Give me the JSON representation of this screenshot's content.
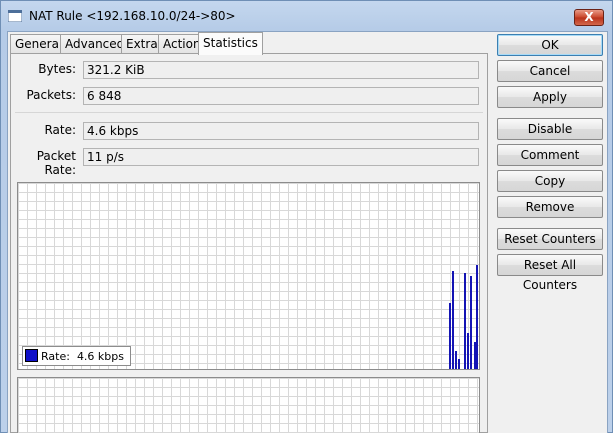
{
  "window": {
    "title": "NAT Rule <192.168.10.0/24->80>",
    "close_label": "X"
  },
  "tabs": [
    {
      "label": "General"
    },
    {
      "label": "Advanced"
    },
    {
      "label": "Extra"
    },
    {
      "label": "Action"
    },
    {
      "label": "Statistics",
      "active": true
    }
  ],
  "stats": {
    "bytes_label": "Bytes:",
    "bytes_value": "321.2 KiB",
    "packets_label": "Packets:",
    "packets_value": "6 848",
    "rate_label": "Rate:",
    "rate_value": "4.6 kbps",
    "packet_rate_label": "Packet Rate:",
    "packet_rate_value": "11 p/s"
  },
  "graph": {
    "legend_label": "Rate:",
    "legend_value": "4.6 kbps",
    "series_color": "#1414b4"
  },
  "buttons": {
    "ok": "OK",
    "cancel": "Cancel",
    "apply": "Apply",
    "disable": "Disable",
    "comment": "Comment",
    "copy": "Copy",
    "remove": "Remove",
    "reset_counters": "Reset Counters",
    "reset_all_counters": "Reset All Counters"
  }
}
